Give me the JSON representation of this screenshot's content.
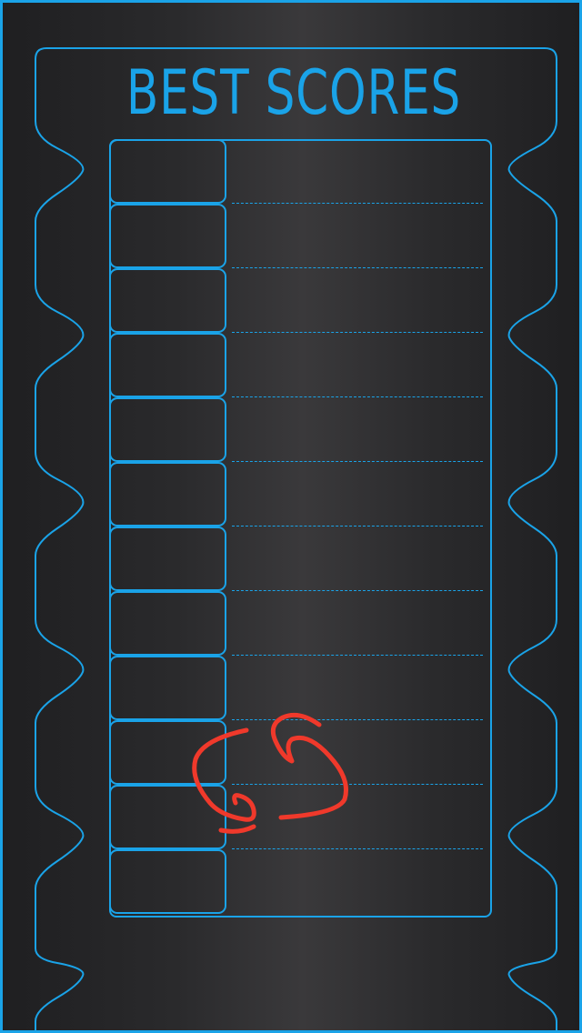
{
  "title": "BEST SCORES",
  "colors": {
    "accent": "#1aa3e8",
    "refresh_icon": "#f0392b",
    "background": "#2a2a2c"
  },
  "icons": {
    "refresh": "refresh-icon"
  },
  "scores": [
    {
      "rank": "",
      "score": ""
    },
    {
      "rank": "",
      "score": ""
    },
    {
      "rank": "",
      "score": ""
    },
    {
      "rank": "",
      "score": ""
    },
    {
      "rank": "",
      "score": ""
    },
    {
      "rank": "",
      "score": ""
    },
    {
      "rank": "",
      "score": ""
    },
    {
      "rank": "",
      "score": ""
    },
    {
      "rank": "",
      "score": ""
    },
    {
      "rank": "",
      "score": ""
    },
    {
      "rank": "",
      "score": ""
    },
    {
      "rank": "",
      "score": ""
    }
  ]
}
